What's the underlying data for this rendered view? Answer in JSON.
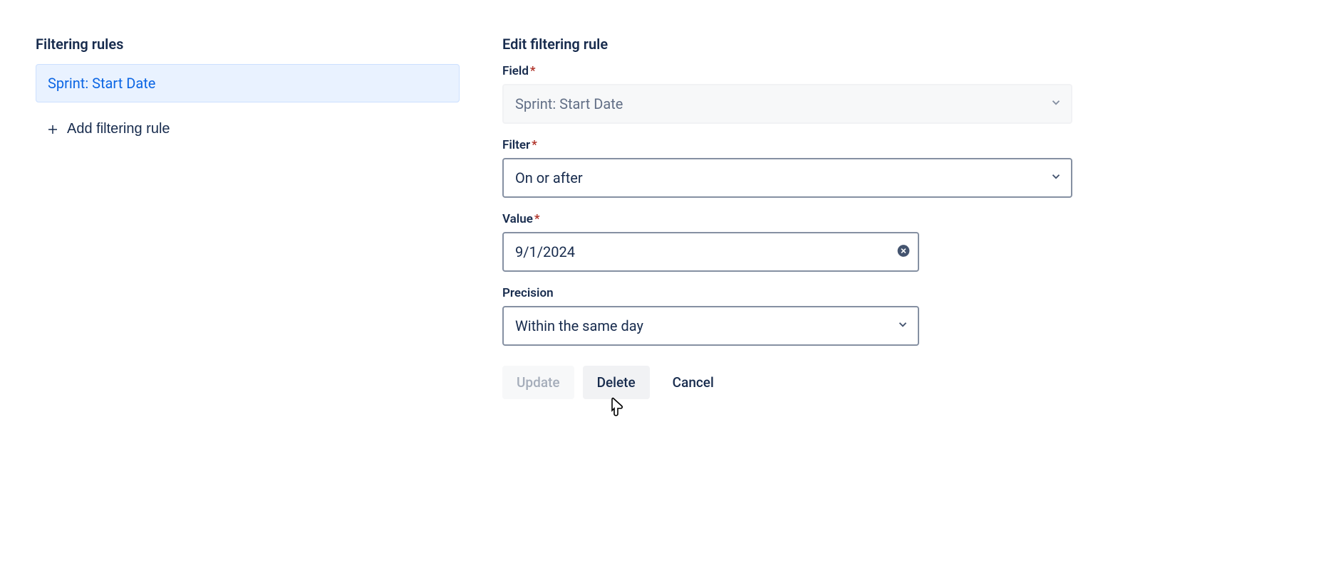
{
  "leftPanel": {
    "title": "Filtering rules",
    "selectedRule": "Sprint: Start Date",
    "addButtonLabel": "Add filtering rule"
  },
  "rightPanel": {
    "title": "Edit filtering rule",
    "fieldLabel": "Field",
    "fieldValue": "Sprint: Start Date",
    "filterLabel": "Filter",
    "filterValue": "On or after",
    "valueLabel": "Value",
    "valueInput": "9/1/2024",
    "precisionLabel": "Precision",
    "precisionValue": "Within the same day",
    "buttons": {
      "update": "Update",
      "delete": "Delete",
      "cancel": "Cancel"
    }
  }
}
